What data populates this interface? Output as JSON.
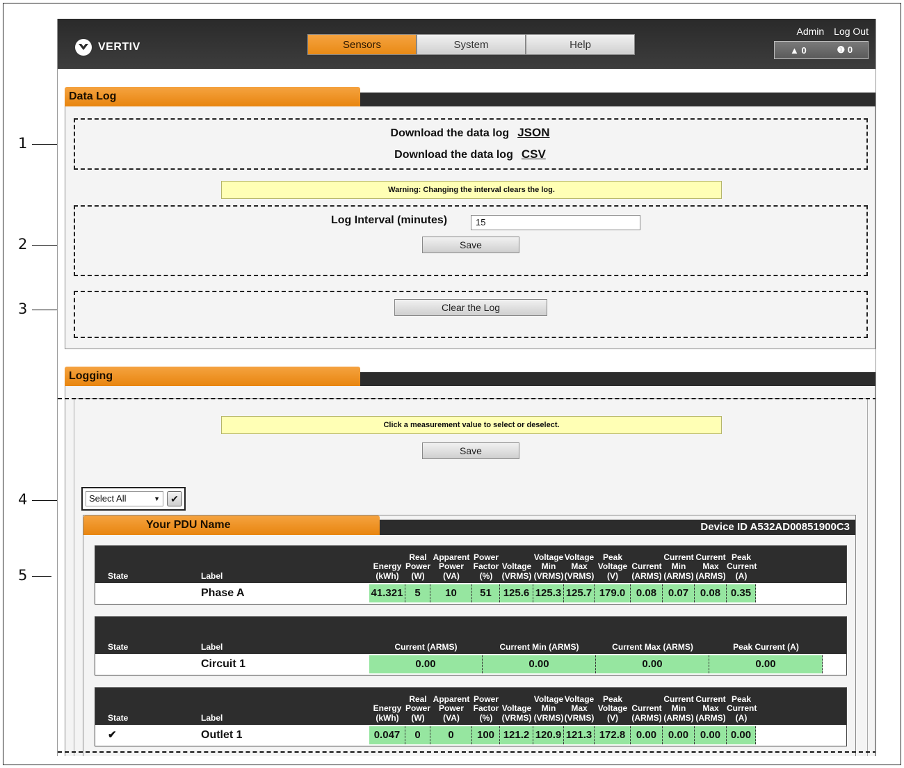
{
  "header": {
    "brand": "VERTIV",
    "nav_tabs": [
      {
        "label": "Sensors"
      },
      {
        "label": "System"
      },
      {
        "label": "Help"
      }
    ],
    "user_link": "Admin",
    "logout_link": "Log Out",
    "alarm_warning_count": "0",
    "alarm_info_count": "0"
  },
  "callouts": [
    "1",
    "2",
    "3",
    "4",
    "5"
  ],
  "data_log": {
    "title": "Data Log",
    "download_label": "Download the data log",
    "json_link": "JSON",
    "csv_link": "CSV",
    "warning": "Warning: Changing the interval clears the log.",
    "interval_label": "Log Interval (minutes)",
    "interval_value": "15",
    "save_label": "Save",
    "clear_label": "Clear the Log"
  },
  "logging": {
    "title": "Logging",
    "hint": "Click a measurement value to select or deselect.",
    "save_label": "Save",
    "select_all": "Select All",
    "pdu_name": "Your PDU Name",
    "device_id": "Device ID A532AD00851900C3",
    "col_state": "State",
    "col_label": "Label",
    "phase": {
      "label": "Phase A",
      "state": "",
      "headers": [
        "Energy (kWh)",
        "Real Power (W)",
        "Apparent Power (VA)",
        "Power Factor (%)",
        "Voltage (VRMS)",
        "Voltage Min (VRMS)",
        "Voltage Max (VRMS)",
        "Peak Voltage (V)",
        "Current (ARMS)",
        "Current Min (ARMS)",
        "Current Max (ARMS)",
        "Peak Current (A)"
      ],
      "values": [
        "41.321",
        "5",
        "10",
        "51",
        "125.6",
        "125.3",
        "125.7",
        "179.0",
        "0.08",
        "0.07",
        "0.08",
        "0.35"
      ]
    },
    "circuit": {
      "label": "Circuit 1",
      "state": "",
      "headers": [
        "Current (ARMS)",
        "Current Min (ARMS)",
        "Current Max (ARMS)",
        "Peak Current (A)"
      ],
      "values": [
        "0.00",
        "0.00",
        "0.00",
        "0.00"
      ]
    },
    "outlet": {
      "label": "Outlet 1",
      "state": "✔",
      "headers": [
        "Energy (kWh)",
        "Real Power (W)",
        "Apparent Power (VA)",
        "Power Factor (%)",
        "Voltage (VRMS)",
        "Voltage Min (VRMS)",
        "Voltage Max (VRMS)",
        "Peak Voltage (V)",
        "Current (ARMS)",
        "Current Min (ARMS)",
        "Current Max (ARMS)",
        "Peak Current (A)"
      ],
      "values": [
        "0.047",
        "0",
        "0",
        "100",
        "121.2",
        "120.9",
        "121.3",
        "172.8",
        "0.00",
        "0.00",
        "0.00",
        "0.00"
      ]
    }
  }
}
